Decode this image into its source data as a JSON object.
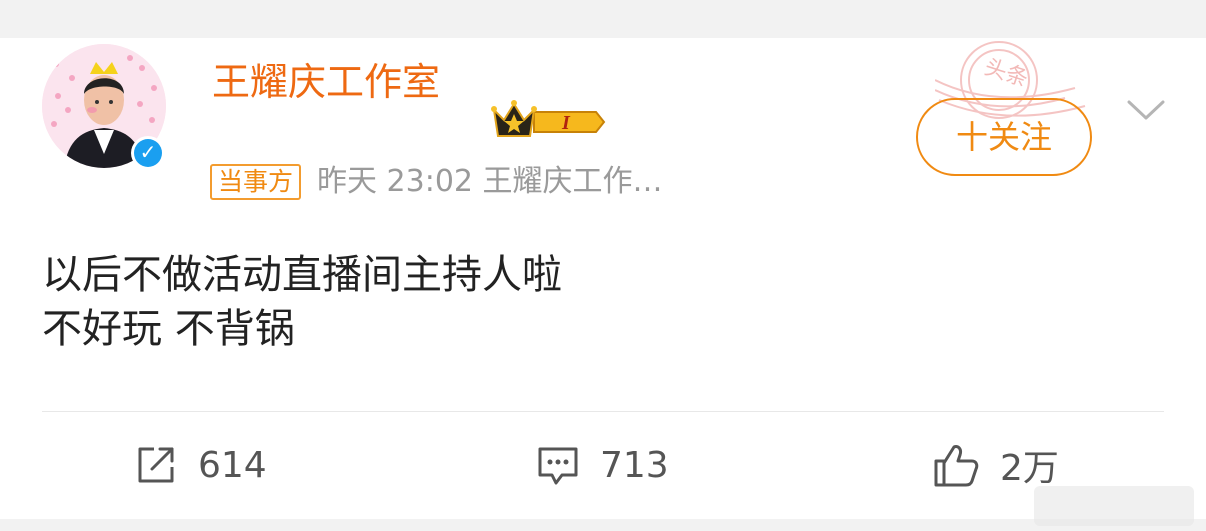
{
  "post": {
    "author_name": "王耀庆工作室",
    "tag": "当事方",
    "meta": "昨天 23:02  王耀庆工作…",
    "follow_label": "十关注",
    "text": "以后不做活动直播间主持人啦\n不好玩 不背锅",
    "vip_level": "I",
    "stamp_text": "头条"
  },
  "actions": {
    "repost_count": "614",
    "comment_count": "713",
    "like_count": "2万"
  },
  "colors": {
    "accent": "#ee6912",
    "verified": "#1a9ff0"
  },
  "icons": [
    "verified-icon",
    "crown-vip-icon",
    "chevron-down-icon",
    "repost-icon",
    "comment-icon",
    "like-icon"
  ]
}
